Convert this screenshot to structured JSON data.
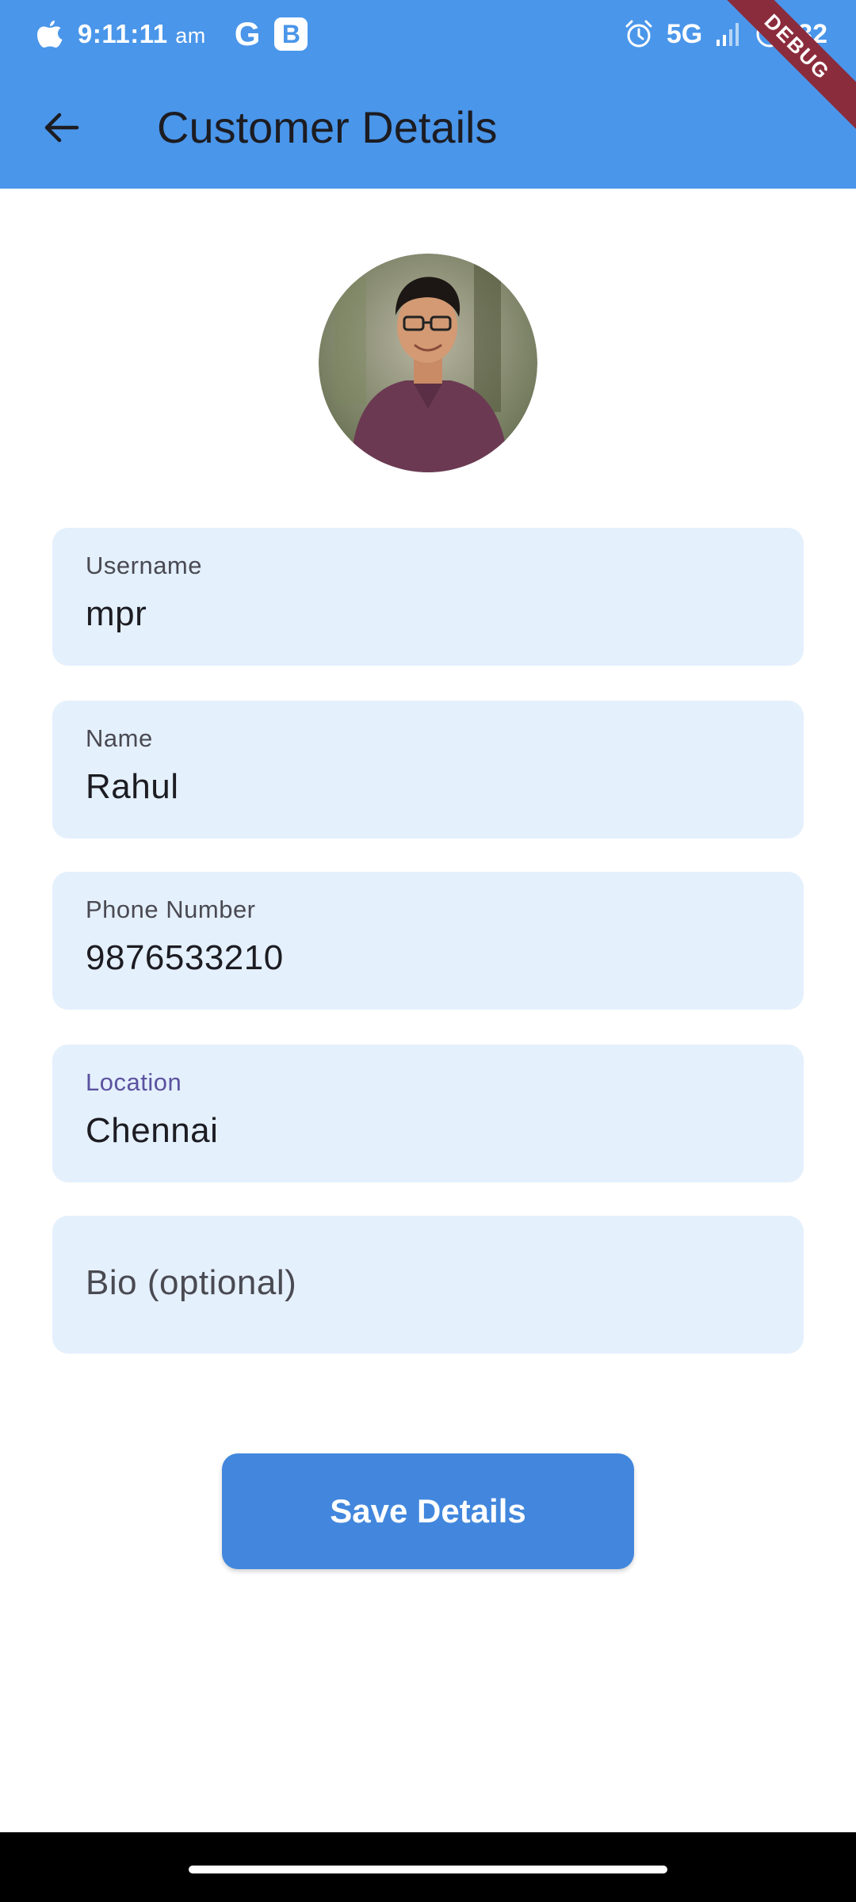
{
  "status_bar": {
    "time": "9:11:11",
    "meridiem": "am",
    "network": "5G",
    "battery": "32",
    "icons": [
      "apple-icon",
      "google-icon",
      "b-app-icon",
      "alarm-icon",
      "signal-icon",
      "battery-saver-icon"
    ]
  },
  "debug_banner": "DEBUG",
  "app_bar": {
    "title": "Customer Details",
    "back_icon": "arrow-back-icon"
  },
  "avatar": {
    "alt": "profile photo"
  },
  "form": {
    "username": {
      "label": "Username",
      "value": "mpr"
    },
    "name": {
      "label": "Name",
      "value": "Rahul"
    },
    "phone": {
      "label": "Phone Number",
      "value": "9876533210"
    },
    "location": {
      "label": "Location",
      "value": "Chennai"
    },
    "bio": {
      "placeholder": "Bio (optional)"
    }
  },
  "save_button": {
    "label": "Save Details"
  },
  "colors": {
    "primary": "#4a96ea",
    "button": "#4287dd",
    "field_bg": "#e4f0fc",
    "focused_label": "#5b52a0"
  }
}
